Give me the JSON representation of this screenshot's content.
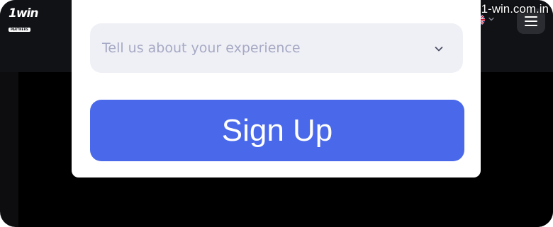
{
  "header": {
    "logo_text": "1win",
    "logo_subtext": "PARTNERS",
    "language_flag": "uk-flag-icon",
    "language_chevron": "chevron-down-icon",
    "menu_icon": "hamburger-menu-icon"
  },
  "watermark": "1-win.com.in",
  "form": {
    "experience_placeholder": "Tell us about your experience",
    "experience_chevron": "chevron-down-icon",
    "signup_label": "Sign Up"
  },
  "colors": {
    "page_bg": "#0d0d10",
    "header_bg": "#111216",
    "content_bg": "#000000",
    "modal_bg": "#ffffff",
    "select_bg": "#eff0f6",
    "placeholder_text": "#a6a9c4",
    "primary_button": "#4a68ea",
    "menu_button_bg": "#2b2c31"
  }
}
